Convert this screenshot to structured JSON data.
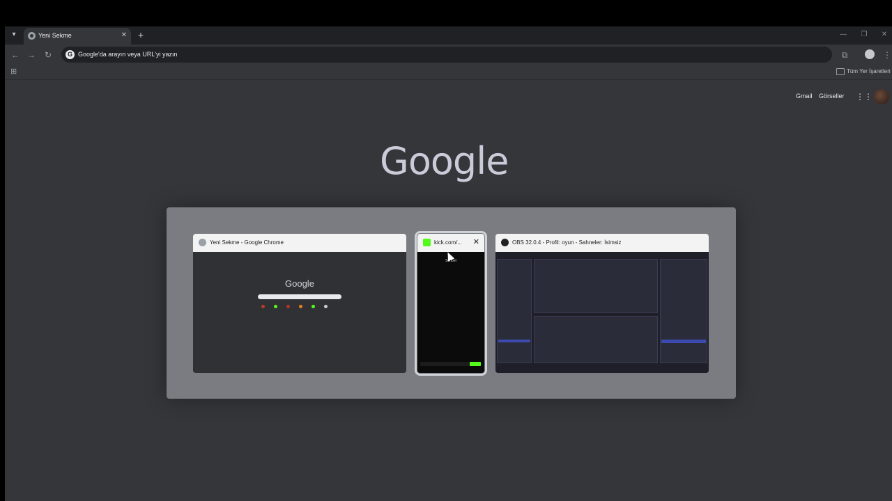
{
  "browser": {
    "tab": {
      "title": "Yeni Sekme",
      "close": "✕"
    },
    "new_tab": "+",
    "window_controls": {
      "minimize": "—",
      "maximize": "❐",
      "close": "✕"
    },
    "omnibox": {
      "placeholder": "Google'da arayın veya URL'yi yazın",
      "g": "G"
    },
    "bookmarks": {
      "all_bookmarks": "Tüm Yer İşaretleri"
    }
  },
  "ntp": {
    "links": {
      "gmail": "Gmail",
      "images": "Görseller"
    },
    "logo": "Google"
  },
  "switcher": {
    "cards": [
      {
        "title": "Yeni Sekme - Google Chrome",
        "mini_logo": "Google"
      },
      {
        "title": "kick.com/...",
        "label": "Sohbet",
        "selected": true
      },
      {
        "title": "OBS 32.0.4 - Profil: oyun - Sahneler: İsimsiz"
      }
    ]
  },
  "colors": {
    "kick_green": "#53fc18",
    "obs_blue": "#3c4ab0"
  }
}
